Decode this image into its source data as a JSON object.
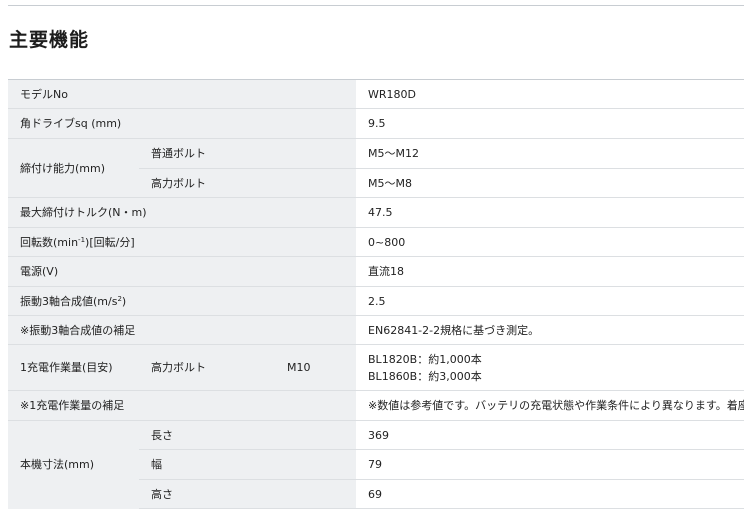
{
  "page": {
    "title": "主要機能"
  },
  "rows": {
    "model": {
      "label": "モデルNo",
      "value": "WR180D"
    },
    "square_drive": {
      "label": "角ドライブsq (mm)",
      "value": "9.5"
    },
    "tightening": {
      "label": "締付け能力(mm)",
      "normal_bolt": {
        "label": "普通ボルト",
        "value": "M5～M12"
      },
      "high_tension_bolt": {
        "label": "高力ボルト",
        "value": "M5～M8"
      }
    },
    "max_torque": {
      "label": "最大締付けトルク(N・m)",
      "value": "47.5"
    },
    "rpm": {
      "label_pre": "回転数(min",
      "label_sup": "-1",
      "label_post": ")[回転/分]",
      "value": "0~800"
    },
    "power": {
      "label": "電源(V)",
      "value": "直流18"
    },
    "vibration": {
      "label_pre": "振動3軸合成値(m/s",
      "label_sup": "2",
      "label_post": ")",
      "value": "2.5"
    },
    "vibration_note": {
      "label": "※振動3軸合成値の補足",
      "value": "EN62841-2-2規格に基づき測定。"
    },
    "work_per_charge": {
      "label": "1充電作業量(目安)",
      "sub_label": "高力ボルト",
      "size": "M10",
      "value_line1": "BL1820B：約1,000本",
      "value_line2": "BL1860B：約3,000本"
    },
    "work_note": {
      "label": "※1充電作業量の補足",
      "value": "※数値は参考値です。バッテリの充電状態や作業条件により異なります。着座時。"
    },
    "dimensions": {
      "label": "本機寸法(mm)",
      "length": {
        "label": "長さ",
        "value": "369"
      },
      "width": {
        "label": "幅",
        "value": "79"
      },
      "height": {
        "label": "高さ",
        "value": "69"
      }
    }
  }
}
